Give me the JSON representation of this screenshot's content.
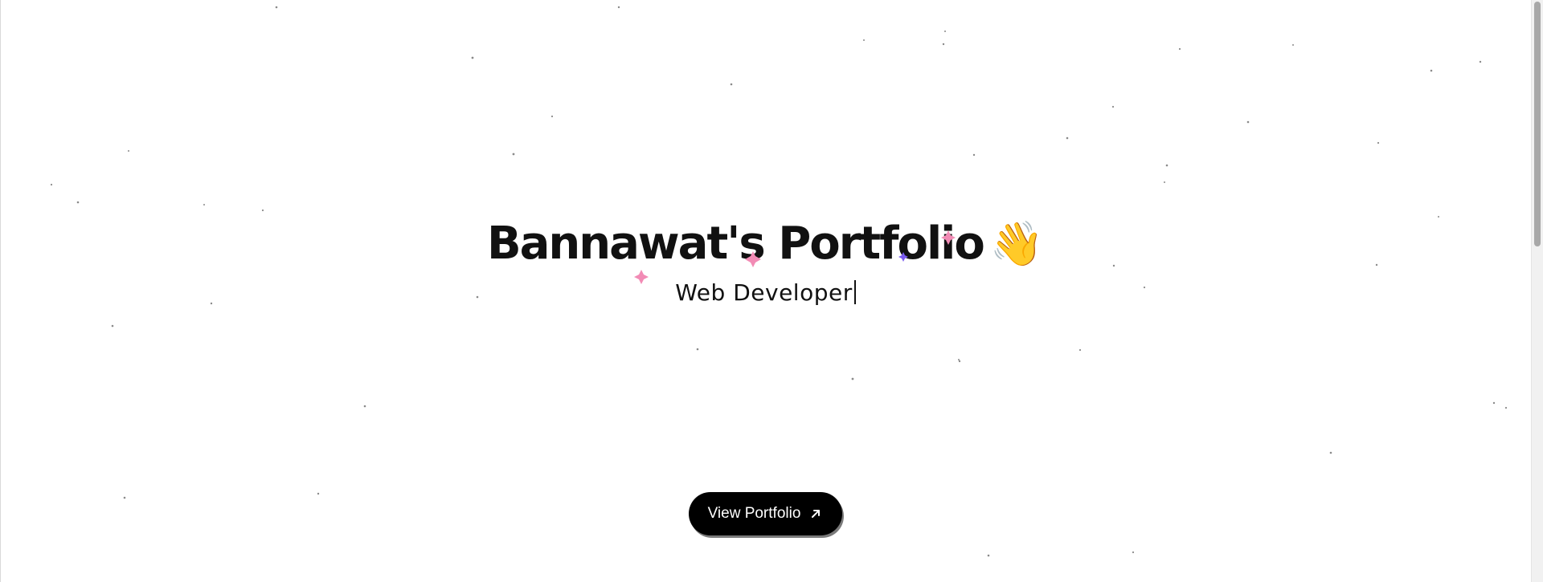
{
  "hero": {
    "title": "Bannawat's Portfolio",
    "wave_emoji": "👋",
    "subtitle": "Web Developer"
  },
  "cta": {
    "label": "View Portfolio",
    "icon": "arrow-up-right-icon"
  },
  "colors": {
    "background": "#ffffff",
    "text": "#111111",
    "button_bg": "#000000",
    "button_text": "#ffffff",
    "sparkle_pink": "#f28bb5",
    "sparkle_purple": "#7b5cf0",
    "star_dot": "#8a8a8a"
  }
}
